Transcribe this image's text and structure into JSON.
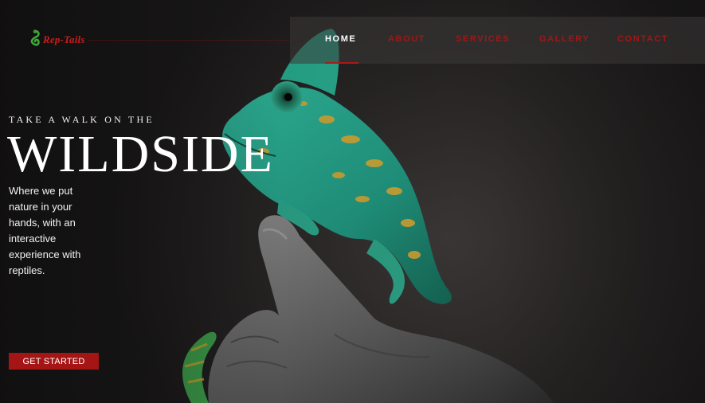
{
  "brand": {
    "name": "Rep-Tails",
    "logo_icon": "snake-icon",
    "accent_color": "#a51515"
  },
  "nav": {
    "items": [
      {
        "label": "HOME",
        "active": true
      },
      {
        "label": "ABOUT",
        "active": false
      },
      {
        "label": "SERVICES",
        "active": false
      },
      {
        "label": "GALLERY",
        "active": false
      },
      {
        "label": "CONTACT",
        "active": false
      }
    ]
  },
  "hero": {
    "eyebrow": "TAKE A WALK ON THE",
    "headline": "WILDSIDE",
    "description": "Where we put nature in your hands, with an interactive experience with reptiles.",
    "cta_label": "GET STARTED",
    "image_subject": "chameleon-on-hand"
  }
}
